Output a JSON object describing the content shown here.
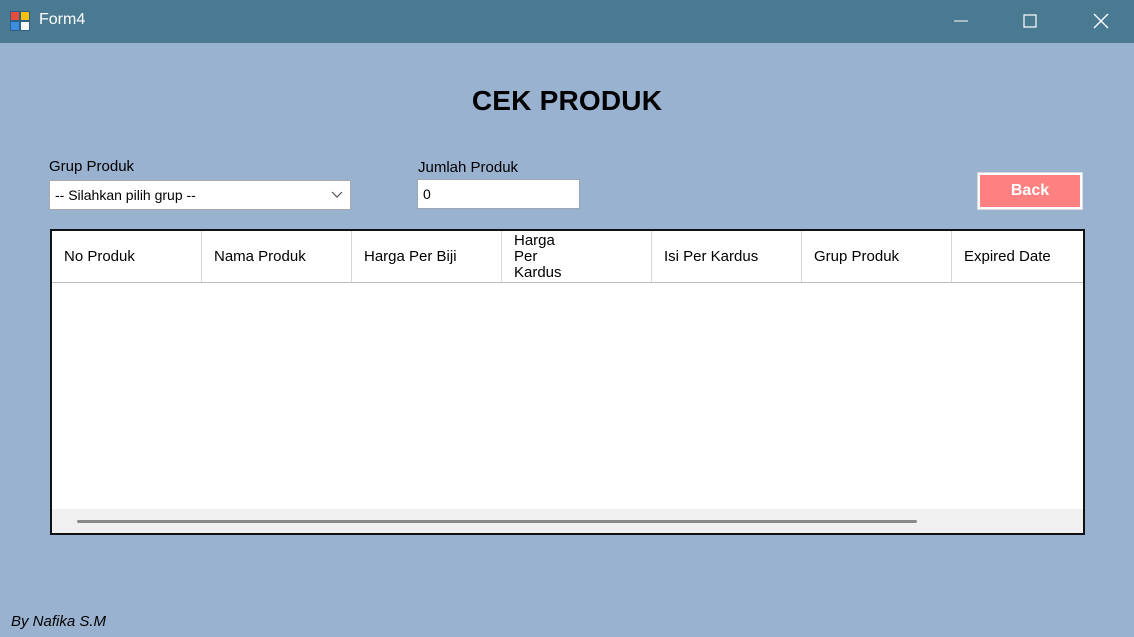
{
  "window": {
    "title": "Form4"
  },
  "page": {
    "heading": "CEK PRODUK"
  },
  "filters": {
    "grup_label": "Grup Produk",
    "grup_selected": "-- Silahkan pilih grup --",
    "jumlah_label": "Jumlah Produk",
    "jumlah_value": "0"
  },
  "actions": {
    "back_label": "Back"
  },
  "table": {
    "columns": [
      "No Produk",
      "Nama Produk",
      "Harga Per Biji",
      "Harga Per Kardus",
      "Isi Per Kardus",
      "Grup Produk",
      "Expired Date"
    ],
    "rows": []
  },
  "footer": {
    "signature": "By Nafika S.M"
  },
  "colors": {
    "titlebar": "#4a7a91",
    "background": "#99b2cf",
    "back_button": "#ff8080"
  }
}
